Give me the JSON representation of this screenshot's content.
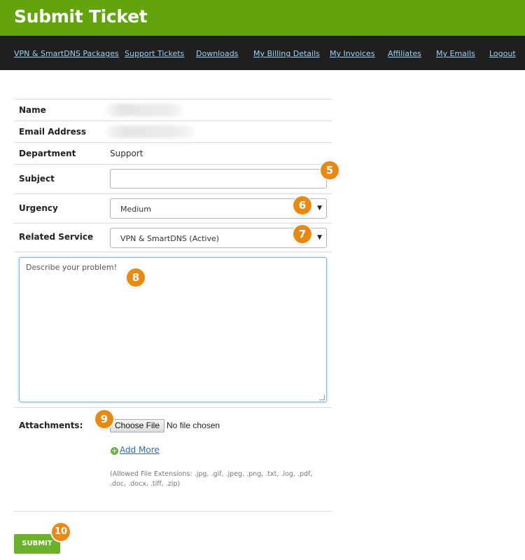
{
  "header": {
    "title": "Submit Ticket"
  },
  "nav": [
    {
      "label": "VPN & SmartDNS Packages"
    },
    {
      "label": "Support Tickets"
    },
    {
      "label": "Downloads"
    },
    {
      "label": "My Billing Details"
    },
    {
      "label": "My Invoices"
    },
    {
      "label": "Affiliates"
    },
    {
      "label": "My Emails"
    },
    {
      "label": "Logout"
    }
  ],
  "form": {
    "name_label": "Name",
    "email_label": "Email Address",
    "department_label": "Department",
    "department_value": "Support",
    "subject_label": "Subject",
    "subject_value": "",
    "urgency_label": "Urgency",
    "urgency_value": "Medium",
    "service_label": "Related Service",
    "service_value": "VPN & SmartDNS (Active)",
    "message_placeholder": "Describe your problem!",
    "attachments_label": "Attachments:",
    "choose_file_label": "Choose File",
    "file_status": "No file chosen",
    "add_more_label": "Add More",
    "allowed_extensions": "(Allowed File Extensions: .jpg, .gif, .jpeg, .png, .txt, .log, .pdf, .doc, .docx, .tiff, .zip)",
    "submit_label": "SUBMIT"
  },
  "badges": [
    "5",
    "6",
    "7",
    "8",
    "9",
    "10"
  ],
  "colors": {
    "header_bg": "#63a30e",
    "nav_bg": "#1f1f1f",
    "nav_link": "#9fd2f2",
    "submit_bg": "#6bb22a",
    "badge_bg": "#e88a12"
  }
}
